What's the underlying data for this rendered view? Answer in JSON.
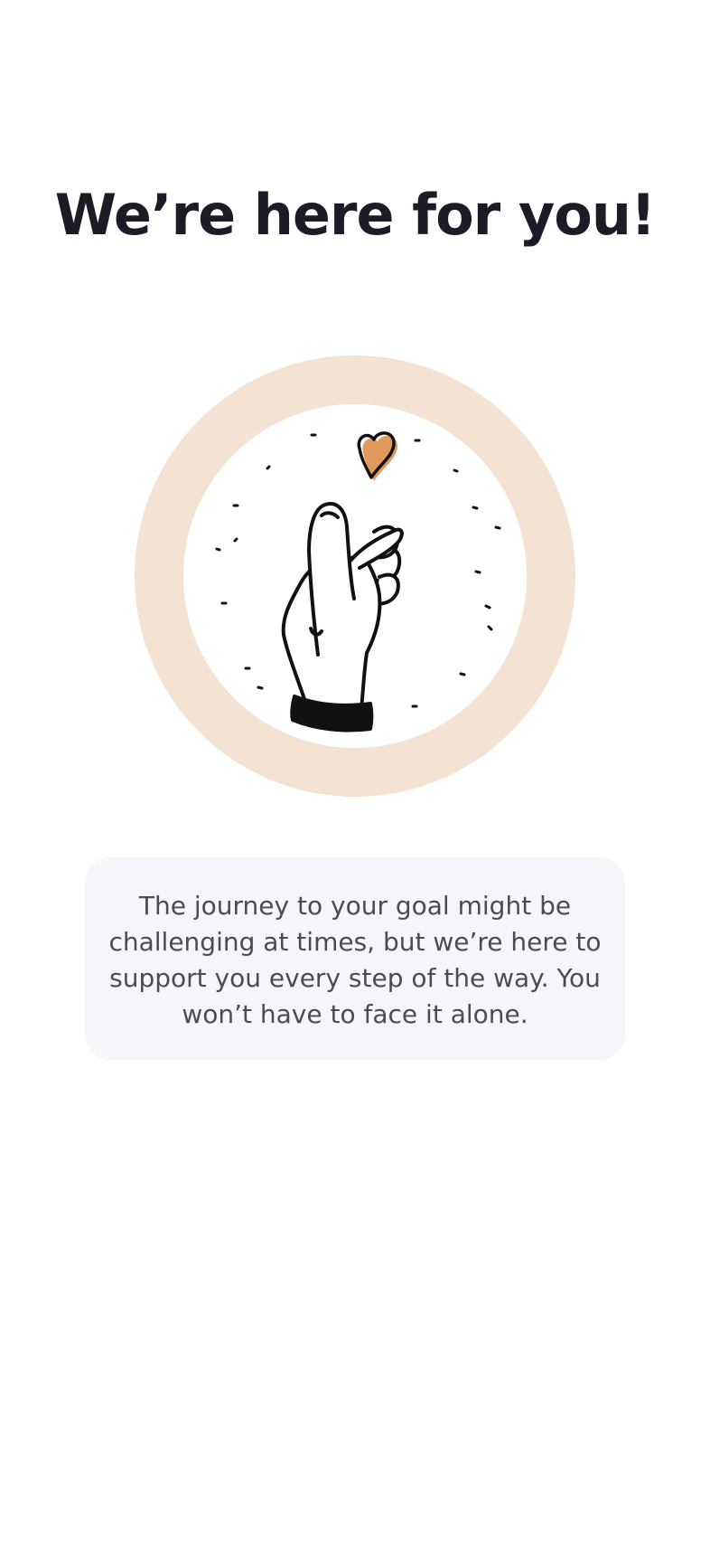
{
  "title": "We’re here for you!",
  "illustration": {
    "icon": "finger-heart-icon",
    "ring_color": "#f4e2d3",
    "heart_color": "#e09a5e"
  },
  "message": {
    "text": "The journey to your goal might be challenging at times, but we’re here to support you every step of the way. You won’t have to face it alone."
  }
}
